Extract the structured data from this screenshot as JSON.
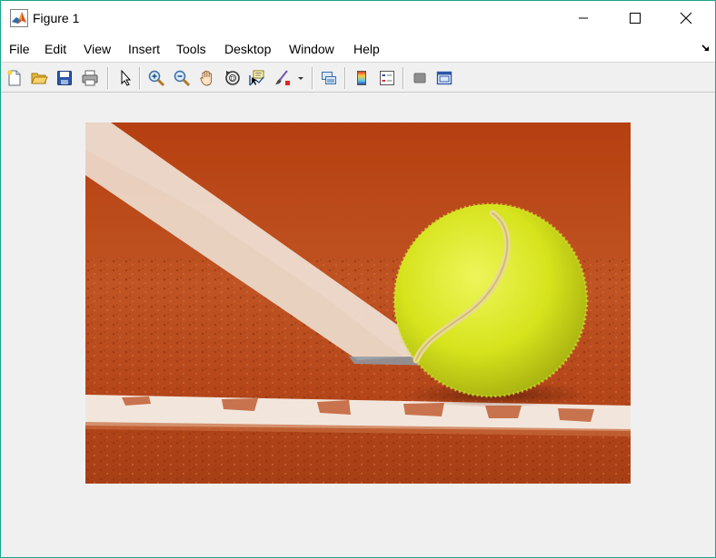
{
  "window": {
    "title": "Figure 1",
    "controls": [
      "minimize",
      "maximize",
      "close"
    ]
  },
  "menu": {
    "items": [
      "File",
      "Edit",
      "View",
      "Insert",
      "Tools",
      "Desktop",
      "Window",
      "Help"
    ]
  },
  "toolbar": {
    "buttons": [
      "new-figure-icon",
      "open-file-icon",
      "save-figure-icon",
      "print-figure-icon",
      "edit-plot-icon",
      "zoom-in-icon",
      "zoom-out-icon",
      "pan-icon",
      "rotate-3d-icon",
      "data-cursor-icon",
      "brush-icon",
      "brush-dropdown-icon",
      "link-plot-icon",
      "insert-colorbar-icon",
      "insert-legend-icon",
      "hide-plot-tools-icon",
      "show-plot-tools-icon"
    ]
  },
  "image": {
    "content": "tennis-ball-on-clay-court"
  },
  "colors": {
    "window_border": "#1aa48a",
    "background": "#f0f0f0",
    "clay": "#b84a1c",
    "ball": "#d7e61e"
  }
}
